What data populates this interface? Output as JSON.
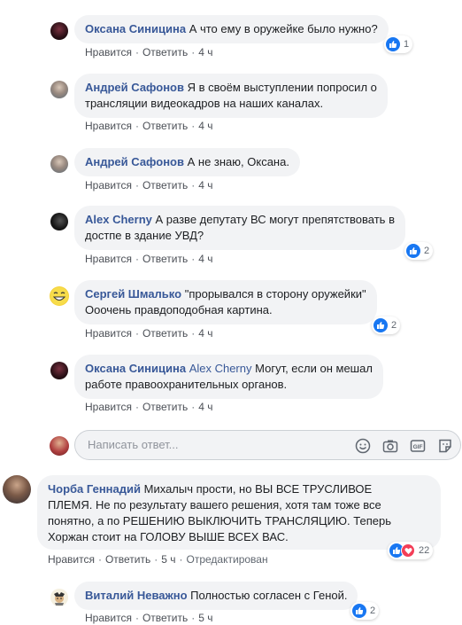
{
  "comments": [
    {
      "author": "Оксана Синицина",
      "text": "А что ему в оружейке было нужно?",
      "like": "Нравится",
      "reply": "Ответить",
      "time": "4 ч",
      "reactions": "1"
    },
    {
      "author": "Андрей Сафонов",
      "text_line1": "Я в своём выступлении попросил о",
      "text_line2": "трансляции видеокадров на наших каналах.",
      "like": "Нравится",
      "reply": "Ответить",
      "time": "4 ч"
    },
    {
      "author": "Андрей Сафонов",
      "text": "А не знаю, Оксана.",
      "like": "Нравится",
      "reply": "Ответить",
      "time": "4 ч"
    },
    {
      "author": "Alex Cherny",
      "text_line1": "А разве депутату ВС могут препятствовать в",
      "text_line2": "достпе в здание УВД?",
      "like": "Нравится",
      "reply": "Ответить",
      "time": "4 ч",
      "reactions": "2"
    },
    {
      "author": "Сергей Шмалько",
      "text_line1": "\"прорывался в сторону оружейки\"",
      "text_line2": "Ооочень правдоподобная картина.",
      "like": "Нравится",
      "reply": "Ответить",
      "time": "4 ч",
      "reactions": "2"
    },
    {
      "author": "Оксана Синицина",
      "mention": "Alex Cherny",
      "text_line1": "Могут, если он мешал",
      "text_line2": "работе правоохранительных органов.",
      "like": "Нравится",
      "reply": "Ответить",
      "time": "4 ч"
    }
  ],
  "reply_box": {
    "placeholder": "Написать ответ..."
  },
  "main_comment": {
    "author": "Чорба Геннадий",
    "text_line1": "Михалыч прости, но ВЫ ВСЕ ТРУСЛИВОЕ",
    "text_line2": "ПЛЕМЯ. Не по результату вашего решения, хотя там тоже все",
    "text_line3": "понятно, а по РЕШЕНИЮ ВЫКЛЮЧИТЬ ТРАНСЛЯЦИЮ. Теперь",
    "text_line4": "Хоржан стоит на ГОЛОВУ ВЫШЕ ВСЕХ ВАС.",
    "like": "Нравится",
    "reply": "Ответить",
    "time": "5 ч",
    "edited": "Отредактирован",
    "reactions": "22"
  },
  "sub_comment": {
    "author": "Виталий Неважно",
    "text": "Полностью согласен с Геной.",
    "like": "Нравится",
    "reply": "Ответить",
    "time": "5 ч",
    "reactions": "2"
  },
  "colors": {
    "link": "#385898",
    "bubble": "#f2f3f5",
    "like": "#1877f2",
    "love": "#f33e58"
  }
}
